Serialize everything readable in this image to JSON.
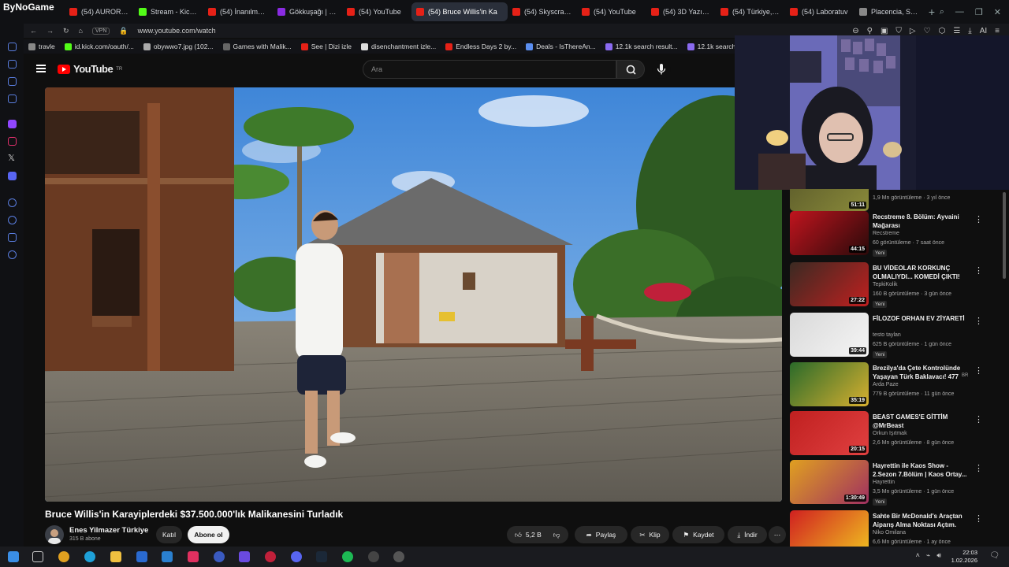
{
  "browser": {
    "brand": "ByNoGame",
    "tabs": [
      {
        "label": "(54) AURORA - I",
        "color": "#e62117"
      },
      {
        "label": "Stream - Kick D",
        "color": "#53fc18"
      },
      {
        "label": "(54) İnanılmaz d",
        "color": "#e62117"
      },
      {
        "label": "Gökkuşağı | Sh",
        "color": "#8a2be2"
      },
      {
        "label": "(54) YouTube",
        "color": "#e62117"
      },
      {
        "label": "(54) Bruce Willis'in Ka",
        "color": "#e62117",
        "active": true
      },
      {
        "label": "(54) Skyscraper",
        "color": "#e62117"
      },
      {
        "label": "(54) YouTube",
        "color": "#e62117"
      },
      {
        "label": "(54) 3D Yazıcıd",
        "color": "#e62117"
      },
      {
        "label": "(54) Türkiye, Ya",
        "color": "#e62117"
      },
      {
        "label": "(54) Laboratuv",
        "color": "#e62117"
      },
      {
        "label": "Placencia, Stann",
        "color": "#888888"
      }
    ],
    "new_tab": "+",
    "vpn": "VPN",
    "url": "www.youtube.com/watch",
    "ai_label": "AI"
  },
  "bookmarks": [
    "travle",
    "id.kick.com/oauth/...",
    "obywwo7.jpg (102...",
    "Games with Malik...",
    "See | Dizi izle",
    "disenchantment izle...",
    "Endless Days 2 by...",
    "Deals - IsThereAn...",
    "12.1k search result...",
    "12.1k search"
  ],
  "youtube": {
    "logo_text": "YouTube",
    "logo_country": "TR",
    "search_placeholder": "Ara"
  },
  "video": {
    "title": "Bruce Willis'in Karayiplerdeki $37.500.000'lık Malikanesini Turladık",
    "channel": "Enes Yilmazer Türkiye",
    "subscribers": "315 B abone",
    "join": "Katıl",
    "subscribe": "Abone ol",
    "likes": "5,2 B",
    "share": "Paylaş",
    "clip": "Klip",
    "save": "Kaydet",
    "download": "İndir"
  },
  "recommendations": [
    {
      "title": "",
      "channel": "",
      "meta": "1,9 Mn görüntüleme · 3 yıl önce",
      "duration": "51:11",
      "new": "",
      "thumb_colors": [
        "#5a5a2a",
        "#8a8a3a"
      ]
    },
    {
      "title": "Recstreme 8. Bölüm: Ayvaini Mağarası",
      "channel": "Recstreme",
      "meta": "60 görüntüleme · 7 saat önce",
      "duration": "44:15",
      "new": "Yeni",
      "thumb_colors": [
        "#c0141e",
        "#2a0a0a"
      ]
    },
    {
      "title": "BU VİDEOLAR KORKUNÇ OLMALIYDI... KOMEDİ ÇIKTI!",
      "channel": "TepkiKolik",
      "meta": "160 B görüntüleme · 3 gün önce",
      "duration": "27:22",
      "new": "Yeni",
      "thumb_colors": [
        "#3a2a22",
        "#c02020"
      ]
    },
    {
      "title": "FİLOZOF ORHAN EV ZİYARETİ",
      "channel": "testo taylan",
      "meta": "625 B görüntüleme · 1 gün önce",
      "duration": "39:44",
      "new": "Yeni",
      "thumb_colors": [
        "#d9d9d9",
        "#f5f5f5"
      ]
    },
    {
      "title": "Brezilya'da Çete Kontrolünde Yaşayan Türk Baklavacı! 477",
      "channel": "Arda Paze",
      "meta": "779 B görüntüleme · 11 gün önce",
      "duration": "35:19",
      "new": "",
      "thumb_colors": [
        "#2a6a2a",
        "#d8b030"
      ]
    },
    {
      "title": "BEAST GAMES'E GİTTİM @MrBeast",
      "channel": "Orkun Işıtmak",
      "meta": "2,6 Mn görüntüleme · 8 gün önce",
      "duration": "20:15",
      "new": "",
      "thumb_colors": [
        "#c02020",
        "#e04040"
      ]
    },
    {
      "title": "Hayrettin ile Kaos Show - 2.Sezon 7.Bölüm | Kaos Ortay...",
      "channel": "Hayrettin",
      "meta": "3,5 Mn görüntüleme · 1 gün önce",
      "duration": "1:30:49",
      "new": "Yeni",
      "thumb_colors": [
        "#e0a020",
        "#a03060"
      ]
    },
    {
      "title": "Sahte Bir McDonald's Araçtan Aiparış Alma Noktası Açtım.",
      "channel": "Niko Omilana",
      "meta": "6,6 Mn görüntüleme · 1 ay önce",
      "duration": "",
      "new": "",
      "thumb_colors": [
        "#d02020",
        "#f0c020"
      ]
    }
  ],
  "rec_badge_br": "BR",
  "taskbar": {
    "time": "22:03",
    "date": "1.02.2026"
  }
}
